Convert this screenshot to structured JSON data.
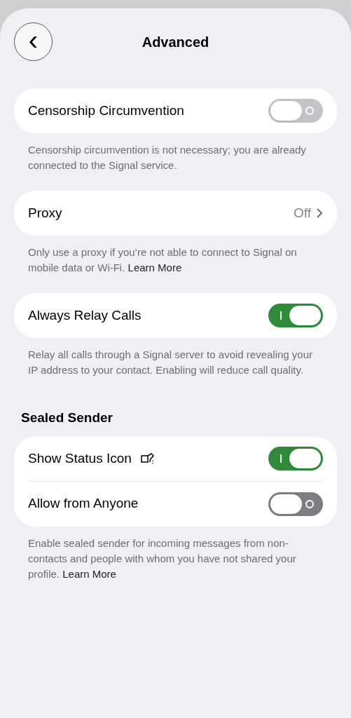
{
  "header": {
    "back": "‹",
    "title": "Advanced"
  },
  "sections": [
    {
      "rows": [
        {
          "kind": "toggle",
          "label": "Censorship Circumvention",
          "on": false,
          "disabled": true
        }
      ],
      "footer": {
        "text": "Censorship circumvention is not necessary; you are already connected to the Signal service."
      }
    },
    {
      "rows": [
        {
          "kind": "disclosure",
          "label": "Proxy",
          "value": "Off"
        }
      ],
      "footer": {
        "text": "Only use a proxy if you’re not able to connect to Signal on mobile data or Wi-Fi.",
        "link": "Learn More"
      }
    },
    {
      "rows": [
        {
          "kind": "toggle",
          "label": "Always Relay Calls",
          "on": true,
          "disabled": false
        }
      ],
      "footer": {
        "text": "Relay all calls through a Signal server to avoid revealing your IP address to your contact. Enabling will reduce call quality."
      }
    },
    {
      "title": "Sealed Sender",
      "rows": [
        {
          "kind": "toggle",
          "label": "Show Status Icon",
          "icon": true,
          "on": true,
          "disabled": false
        },
        {
          "kind": "toggle",
          "label": "Allow from Anyone",
          "on": false,
          "disabled": false
        }
      ],
      "footer": {
        "text": "Enable sealed sender for incoming messages from non-contacts and people with whom you have not shared your profile.",
        "link": "Learn More"
      }
    }
  ]
}
